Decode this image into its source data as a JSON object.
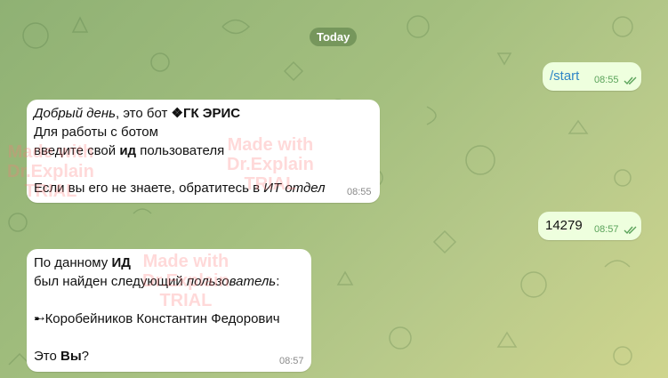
{
  "date_separator": "Today",
  "messages": [
    {
      "type": "out",
      "text": "/start",
      "time": "08:55"
    },
    {
      "type": "in",
      "time": "08:55",
      "line1": {
        "a": "Добрый день",
        "b": ", это бот ",
        "c": "❖ГК ЭРИС"
      },
      "line2": "Для работы с ботом",
      "line3": {
        "a": "введите свой ",
        "b": "ид",
        "c": " пользователя"
      },
      "line4": {
        "a": "Если вы его не знаете, обратитесь в ",
        "b": "ИТ отдел"
      }
    },
    {
      "type": "out",
      "text": "14279",
      "time": "08:57"
    },
    {
      "type": "in",
      "time": "08:57",
      "line1": {
        "a": "По данному ",
        "b": "ИД"
      },
      "line2": {
        "a": "был найден следующий ",
        "b": "пользователь",
        "c": ":"
      },
      "line3": "➸Коробейников Константин Федорович",
      "line4": {
        "a": "Это ",
        "b": "Вы",
        "c": "?"
      }
    }
  ],
  "watermark": {
    "line1": "Made with",
    "line2": "Dr.Explain",
    "line3": "TRIAL"
  },
  "colors": {
    "outgoing": "#eeffde",
    "incoming": "#ffffff",
    "time_out": "#5aa35a",
    "command_link": "#2f86c6"
  }
}
